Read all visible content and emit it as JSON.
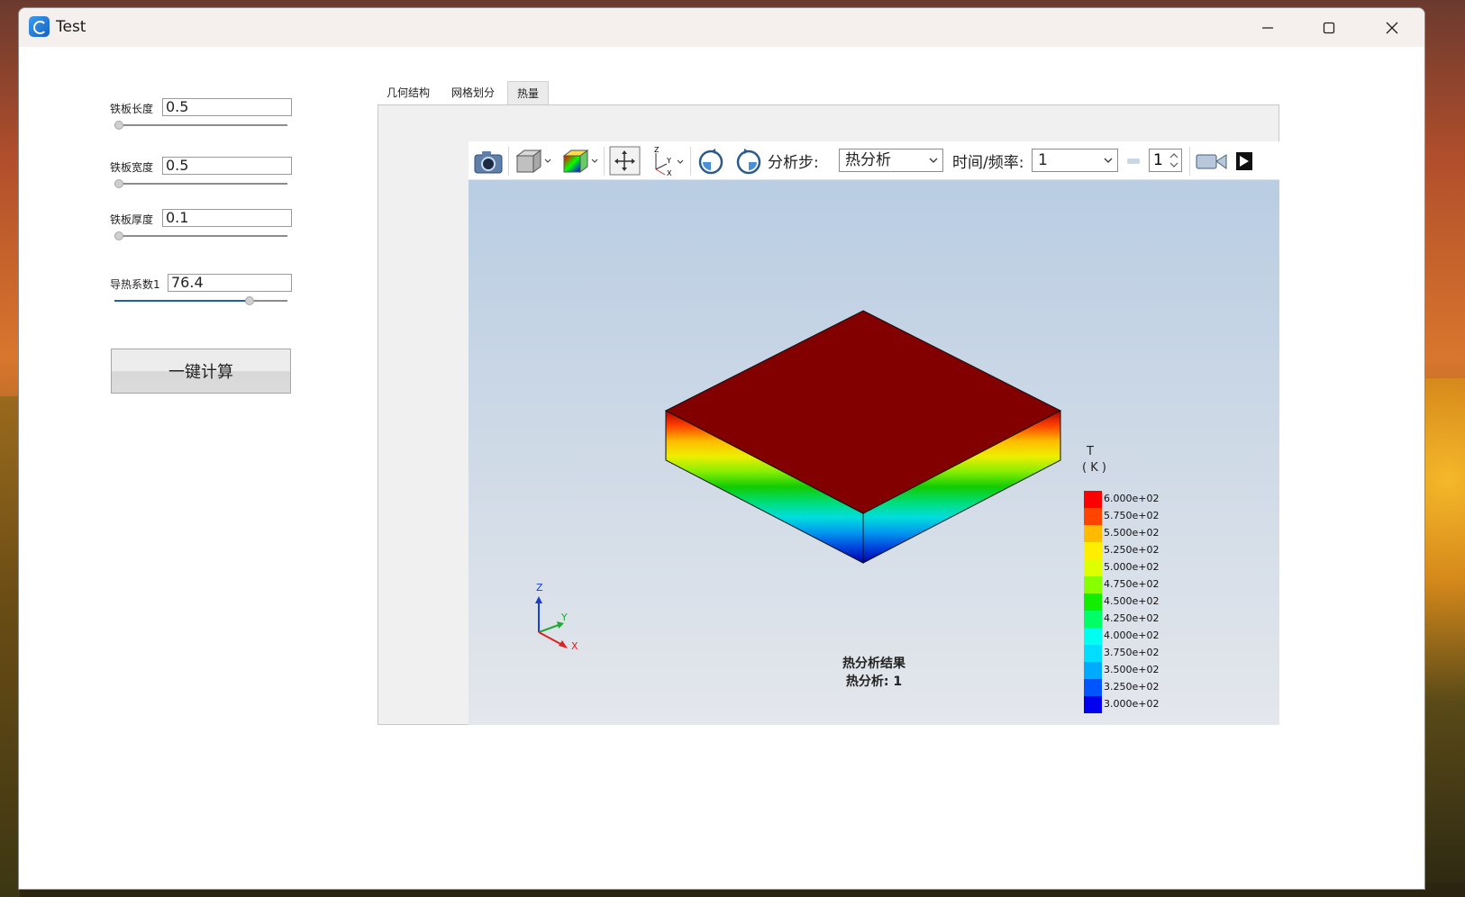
{
  "window": {
    "title": "Test",
    "controls": [
      "minimize",
      "maximize",
      "close"
    ]
  },
  "params": [
    {
      "label": "铁板长度",
      "value": "0.5",
      "slider_fraction": 0.0
    },
    {
      "label": "铁板宽度",
      "value": "0.5",
      "slider_fraction": 0.0
    },
    {
      "label": "铁板厚度",
      "value": "0.1",
      "slider_fraction": 0.0
    },
    {
      "label": "导热系数1",
      "value": "76.4",
      "slider_fraction": 0.78
    }
  ],
  "calc_button": "一键计算",
  "tabs": [
    {
      "label": "几何结构",
      "active": false
    },
    {
      "label": "网格划分",
      "active": false
    },
    {
      "label": "热量",
      "active": true
    }
  ],
  "toolbar": {
    "icons": [
      "camera-icon",
      "view-cube-icon",
      "color-cube-icon",
      "pan-icon",
      "axes-icon",
      "rotate-cw-icon",
      "rotate-ccw-icon",
      "video-icon",
      "play-icon"
    ],
    "step_label": "分析步:",
    "step_value": "热分析",
    "time_label": "时间/频率:",
    "time_value": "1",
    "frame_value": "1"
  },
  "legend": {
    "title_line1": "T",
    "title_line2": "( K )",
    "entries": [
      {
        "label": "6.000e+02",
        "color": "#ff0000"
      },
      {
        "label": "5.750e+02",
        "color": "#ff4400"
      },
      {
        "label": "5.500e+02",
        "color": "#ffbb00"
      },
      {
        "label": "5.250e+02",
        "color": "#ffee00"
      },
      {
        "label": "5.000e+02",
        "color": "#ddff00"
      },
      {
        "label": "4.750e+02",
        "color": "#88ff00"
      },
      {
        "label": "4.500e+02",
        "color": "#11ee00"
      },
      {
        "label": "4.250e+02",
        "color": "#00ff66"
      },
      {
        "label": "4.000e+02",
        "color": "#00ffee"
      },
      {
        "label": "3.750e+02",
        "color": "#00ddff"
      },
      {
        "label": "3.500e+02",
        "color": "#00aaff"
      },
      {
        "label": "3.250e+02",
        "color": "#0055ff"
      },
      {
        "label": "3.000e+02",
        "color": "#0000ee"
      }
    ]
  },
  "axes": {
    "x": "X",
    "y": "Y",
    "z": "Z"
  },
  "caption": {
    "line1": "热分析结果",
    "line2": "热分析: 1"
  },
  "colors": {
    "plate_top": "#820000",
    "accent": "#1e5fa8"
  }
}
